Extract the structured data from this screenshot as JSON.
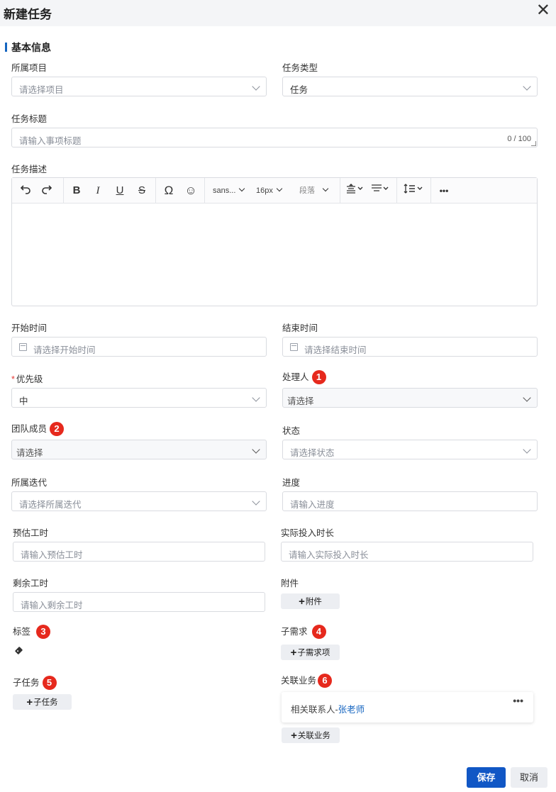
{
  "dialog": {
    "title": "新建任务",
    "close_glyph": "✕"
  },
  "section": {
    "title": "基本信息"
  },
  "fields": {
    "project": {
      "label": "所属项目",
      "placeholder": "请选择项目"
    },
    "task_type": {
      "label": "任务类型",
      "value": "任务"
    },
    "task_title": {
      "label": "任务标题",
      "placeholder": "请输入事项标题",
      "counter": "0 / 100"
    },
    "task_desc": {
      "label": "任务描述"
    },
    "start_time": {
      "label": "开始时间",
      "placeholder": "请选择开始时间"
    },
    "end_time": {
      "label": "结束时间",
      "placeholder": "请选择结束时间"
    },
    "priority": {
      "required_mark": "*",
      "label": "优先级",
      "value": "中"
    },
    "handler": {
      "label": "处理人",
      "badge": "1",
      "placeholder": "请选择"
    },
    "team_members": {
      "label": "团队成员",
      "badge": "2",
      "placeholder": "请选择"
    },
    "status": {
      "label": "状态",
      "placeholder": "请选择状态"
    },
    "iteration": {
      "label": "所属迭代",
      "placeholder": "请选择所属迭代"
    },
    "progress": {
      "label": "进度",
      "placeholder": "请输入进度"
    },
    "estimated_hours": {
      "label": "预估工时",
      "placeholder": "请输入预估工时"
    },
    "actual_hours": {
      "label": "实际投入时长",
      "placeholder": "请输入实际投入时长"
    },
    "remaining_hours": {
      "label": "剩余工时",
      "placeholder": "请输入剩余工时"
    },
    "attachment": {
      "label": "附件",
      "button": "附件"
    },
    "tags": {
      "label": "标签",
      "badge": "3",
      "icon": "tag-icon"
    },
    "sub_requirements": {
      "label": "子需求",
      "badge": "4",
      "button": "子需求项"
    },
    "sub_tasks": {
      "label": "子任务",
      "badge": "5",
      "button": "子任务"
    },
    "related_business": {
      "label": "关联业务",
      "badge": "6",
      "card_prefix": "相关联系人-",
      "card_link": "张老师",
      "card_more": "•••",
      "button": "关联业务"
    }
  },
  "editor_toolbar": {
    "undo": "undo-icon",
    "redo": "redo-icon",
    "bold": "B",
    "italic": "I",
    "underline": "U",
    "strikethrough": "S",
    "special_char": "Ω",
    "emoji": "☺",
    "font_family": "sans...",
    "font_size": "16px",
    "paragraph": "段落",
    "more": "•••"
  },
  "plus_glyph": "+",
  "footer": {
    "save": "保存",
    "cancel": "取消"
  },
  "colors": {
    "primary": "#1157c5",
    "badge": "#e6291d",
    "link": "#1565c0"
  }
}
